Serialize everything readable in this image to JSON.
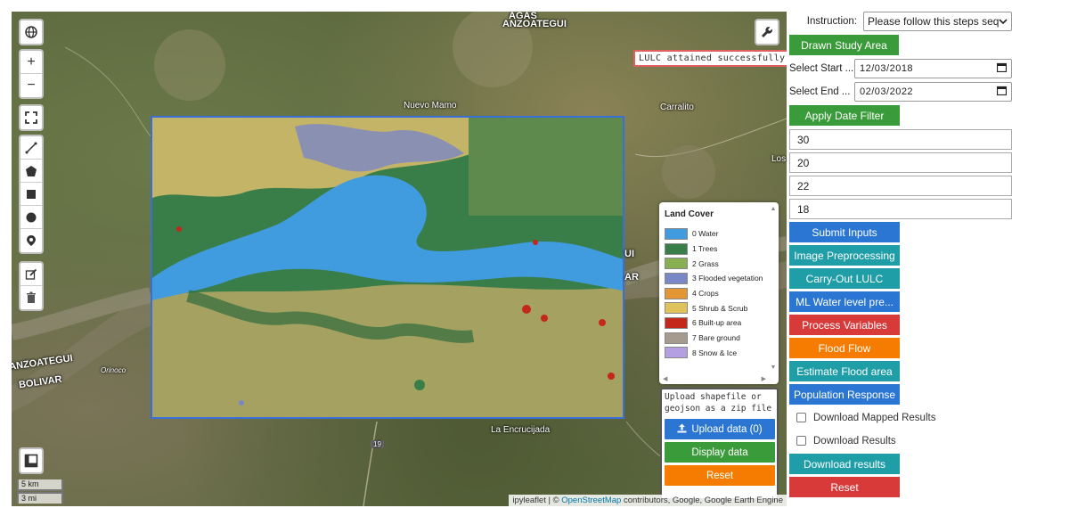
{
  "map": {
    "region_labels": {
      "top": "ANZOATEGUI",
      "top_partial": "AGAS",
      "left_1": "ANZOATEGUI",
      "left_2": "BOLIVAR",
      "river": "Orinoco",
      "right_partial_1": "UI",
      "right_partial_2": "AR"
    },
    "town_labels": {
      "nuevo_mamo": "Nuevo Mamo",
      "carrallito": "Carralito",
      "los": "Los",
      "la_encrucijada": "La Encrucijada",
      "road_19": "19"
    },
    "controls": {
      "globe": "globe-icon",
      "zoom_in": "+",
      "zoom_out": "−",
      "wrench": "wrench-icon"
    },
    "lulc_message": "LULC attained successfully",
    "legend": {
      "title": "Land Cover",
      "items": [
        {
          "label": "0 Water",
          "color": "#419bdf"
        },
        {
          "label": "1 Trees",
          "color": "#397d49"
        },
        {
          "label": "2 Grass",
          "color": "#88b053"
        },
        {
          "label": "3 Flooded vegetation",
          "color": "#7a87c6"
        },
        {
          "label": "4 Crops",
          "color": "#e49635"
        },
        {
          "label": "5 Shrub & Scrub",
          "color": "#dfc35a"
        },
        {
          "label": "6 Built-up area",
          "color": "#c4281b"
        },
        {
          "label": "7 Bare ground",
          "color": "#a59b8f"
        },
        {
          "label": "8 Snow & Ice",
          "color": "#b39fe1"
        }
      ]
    },
    "upload_panel": {
      "text": "Upload shapefile or\ngeojson as a zip file",
      "upload_button": "Upload data (0)",
      "display_button": "Display data",
      "reset_button": "Reset"
    },
    "scale": {
      "km": "5 km",
      "mi": "3 mi"
    },
    "attribution": {
      "prefix": "ipyleaflet | ©",
      "link": "OpenStreetMap",
      "suffix": "contributors, Google, Google Earth Engine"
    }
  },
  "panel": {
    "instruction_label": "Instruction:",
    "instruction_value": "Please follow this steps sequen",
    "drawn_study_area": "Drawn Study Area",
    "start_label": "Select Start ...",
    "start_date": "12/03/2018",
    "end_label": "Select End ...",
    "end_date": "02/03/2022",
    "apply_date_filter": "Apply Date Filter",
    "inputs": [
      "30",
      "20",
      "22",
      "18"
    ],
    "buttons": {
      "submit_inputs": "Submit Inputs",
      "image_preprocessing": "Image Preprocessing",
      "carry_out_lulc": "Carry-Out LULC",
      "ml_water_level": "ML Water level pre...",
      "process_variables": "Process Variables",
      "flood_flow": "Flood Flow",
      "estimate_flood_area": "Estimate Flood area",
      "population_response": "Population Response"
    },
    "check_download_mapped": "Download Mapped Results",
    "check_download_results": "Download Results",
    "download_results_button": "Download results",
    "reset_button": "Reset"
  }
}
